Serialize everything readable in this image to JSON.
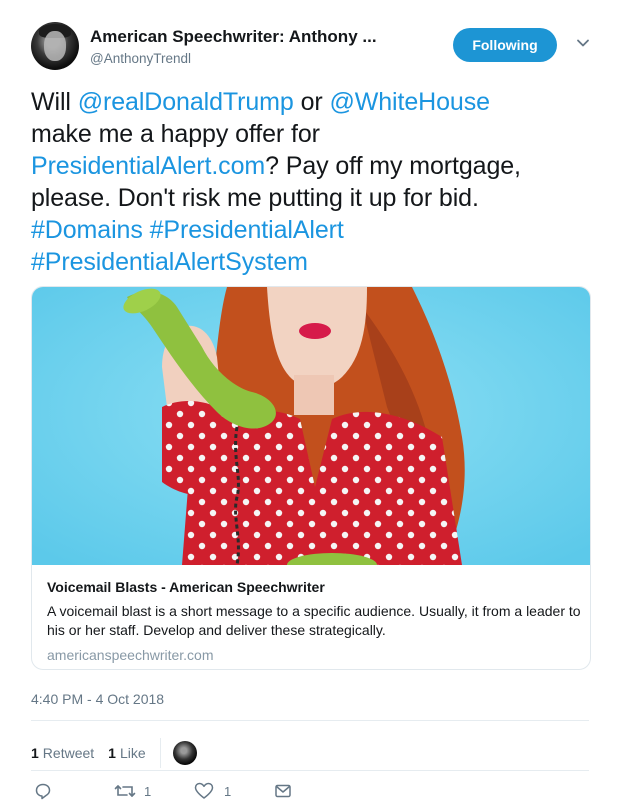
{
  "author": {
    "display_name": "American Speechwriter: Anthony ...",
    "handle": "@AnthonyTrendl",
    "follow_label": "Following"
  },
  "tweet": {
    "lines": [
      [
        {
          "t": "Will ",
          "link": false
        },
        {
          "t": "@realDonaldTrump",
          "link": true
        },
        {
          "t": " or ",
          "link": false
        },
        {
          "t": "@WhiteHouse",
          "link": true
        }
      ],
      [
        {
          "t": "make me a happy offer for",
          "link": false
        }
      ],
      [
        {
          "t": "PresidentialAlert.com",
          "link": true
        },
        {
          "t": "? Pay off my mortgage,",
          "link": false
        }
      ],
      [
        {
          "t": "please. Don't risk me putting it up for bid.",
          "link": false
        }
      ],
      [
        {
          "t": "#Domains",
          "link": true
        },
        {
          "t": " ",
          "link": false
        },
        {
          "t": "#PresidentialAlert",
          "link": true
        }
      ],
      [
        {
          "t": "#PresidentialAlertSystem",
          "link": true
        }
      ]
    ]
  },
  "card": {
    "title": "Voicemail Blasts - American Speechwriter",
    "description": "A voicemail blast is a short message to a specific audience. Usually, it from a leader to his or her staff. Develop and deliver these strategically.",
    "domain": "americanspeechwriter.com"
  },
  "timestamp": "4:40 PM - 4 Oct 2018",
  "stats": {
    "retweets_count": "1",
    "retweets_label": "Retweet",
    "likes_count": "1",
    "likes_label": "Like"
  },
  "actions": {
    "reply_count": "",
    "retweet_count": "1",
    "like_count": "1"
  },
  "icons": [
    "chevron-down-icon",
    "reply-icon",
    "retweet-icon",
    "heart-icon",
    "message-icon"
  ],
  "colors": {
    "link": "#1b95e0",
    "follow_button": "#1d95d4",
    "secondary_text": "#657786",
    "card_background": "#6dd2ee",
    "dress": "#d4232f",
    "phone": "#8fc13f"
  }
}
